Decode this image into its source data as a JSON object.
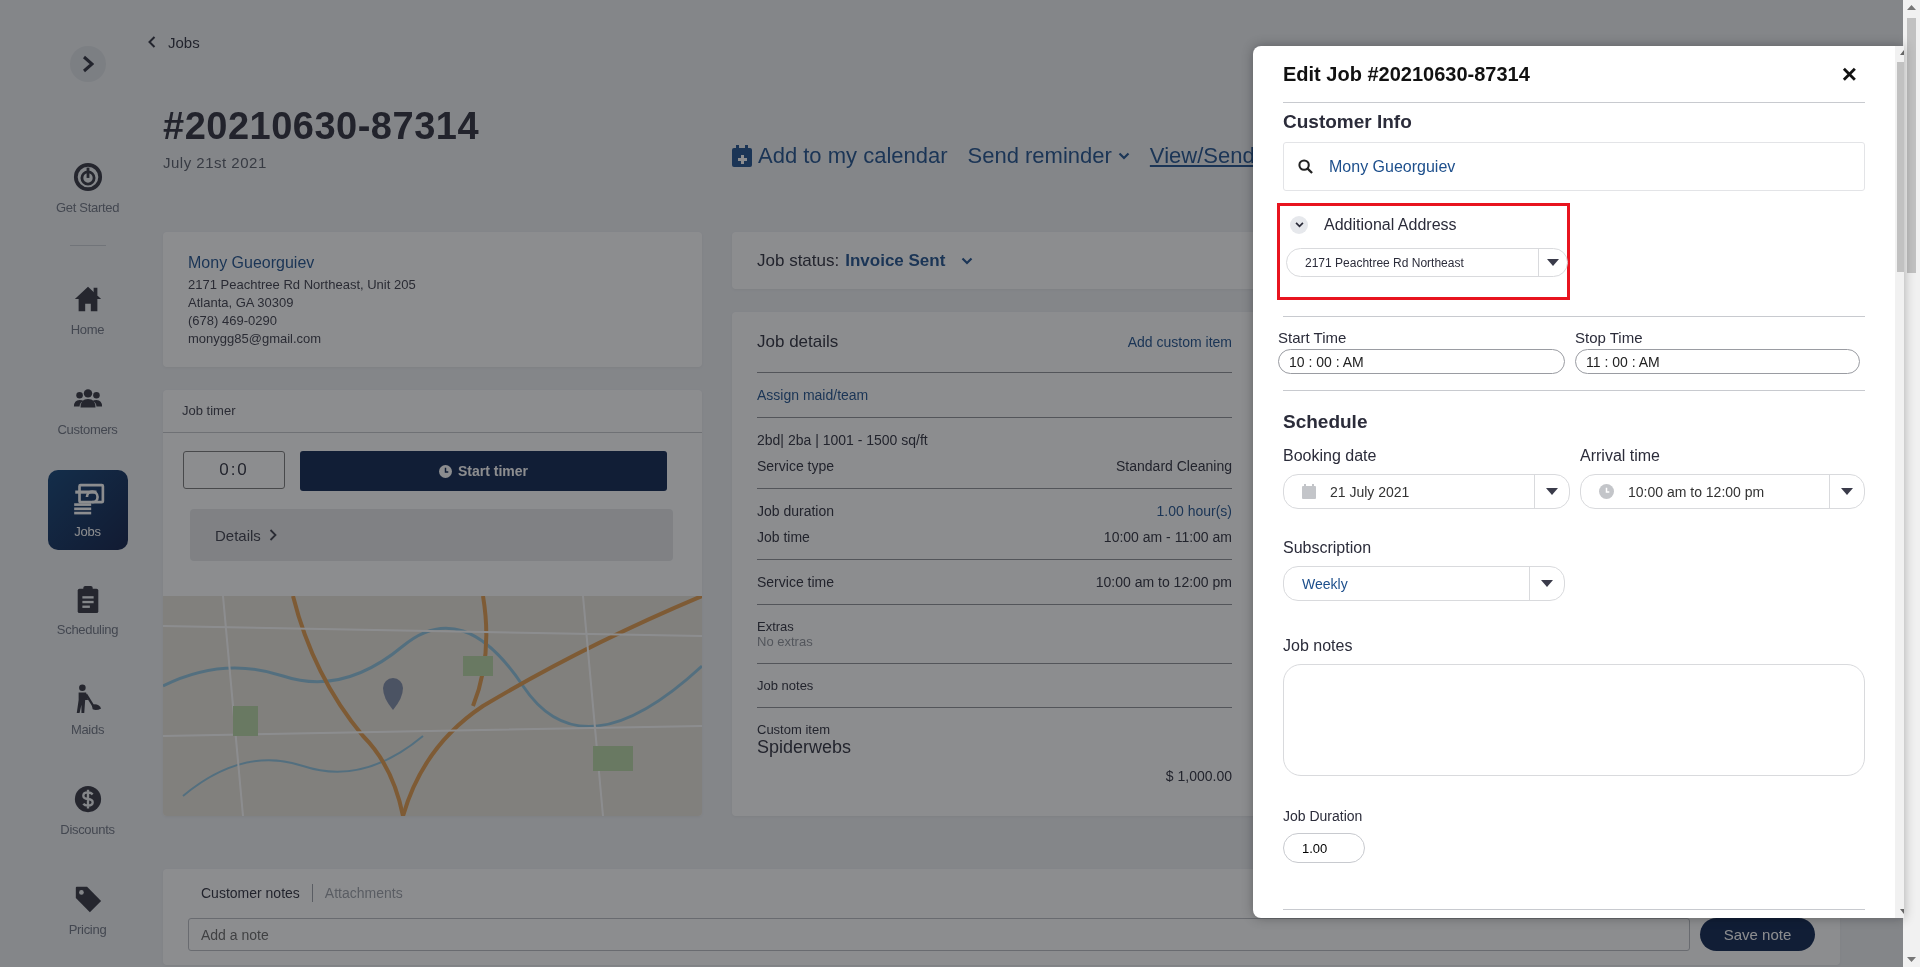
{
  "sidebar": {
    "items": [
      {
        "label": "Get Started",
        "selected": false
      },
      {
        "label": "Home",
        "selected": false
      },
      {
        "label": "Customers",
        "selected": false
      },
      {
        "label": "Jobs",
        "selected": true
      },
      {
        "label": "Scheduling",
        "selected": false
      },
      {
        "label": "Maids",
        "selected": false
      },
      {
        "label": "Discounts",
        "selected": false
      },
      {
        "label": "Pricing",
        "selected": false
      }
    ]
  },
  "breadcrumb": {
    "label": "Jobs"
  },
  "job": {
    "title": "#20210630-87314",
    "date": "July 21st 2021"
  },
  "actions": [
    {
      "kind": "calendar",
      "label": "Add to my calendar"
    },
    {
      "kind": "dropdown",
      "label": "Send reminder"
    },
    {
      "kind": "link",
      "label": "View/Send"
    }
  ],
  "customer_card": {
    "name": "Mony Gueorguiev",
    "lines": [
      "2171 Peachtree Rd Northeast, Unit 205",
      "Atlanta, GA 30309",
      "(678) 469-0290",
      "monygg85@gmail.com"
    ]
  },
  "job_timer": {
    "title": "Job timer",
    "display": "0:0",
    "button": "Start timer",
    "details": "Details"
  },
  "job_status": {
    "label": "Job status:",
    "value": "Invoice Sent"
  },
  "job_details": {
    "title": "Job details",
    "action": "Add custom item",
    "sections": [
      {
        "rows": [
          {
            "kind": "link",
            "label": "Assign maid/team"
          }
        ]
      },
      {
        "rows": [
          {
            "kind": "text",
            "label": "2bd| 2ba | 1001 - 1500 sq/ft"
          },
          {
            "kind": "pair",
            "label": "Service type",
            "value": "Standard Cleaning"
          }
        ]
      },
      {
        "rows": [
          {
            "kind": "pair_link",
            "label": "Job duration",
            "value": "1.00 hour(s)"
          },
          {
            "kind": "pair",
            "label": "Job time",
            "value": "10:00 am - 11:00 am"
          }
        ]
      },
      {
        "rows": [
          {
            "kind": "pair",
            "label": "Service time",
            "value": "10:00 am to 12:00 pm"
          }
        ]
      },
      {
        "rows": [
          {
            "kind": "stack_muted",
            "label": "Extras",
            "value": "No extras"
          }
        ]
      },
      {
        "rows": [
          {
            "kind": "text_small",
            "label": "Job notes"
          }
        ]
      },
      {
        "rows": [
          {
            "kind": "stack_large",
            "label": "Custom item",
            "value": "Spiderwebs"
          },
          {
            "kind": "price",
            "label": "$ 1,000.00"
          }
        ]
      }
    ]
  },
  "notes": {
    "tabs": [
      {
        "label": "Customer notes",
        "selected": true
      },
      {
        "label": "Attachments",
        "selected": false
      }
    ],
    "placeholder": "Add a note",
    "button": "Save note"
  },
  "modal": {
    "title": "Edit Job #20210630-87314",
    "close": "×",
    "customer_info": {
      "heading": "Customer Info",
      "value": "Mony Gueorguiev"
    },
    "additional_address": {
      "label": "Additional Address",
      "expanded": true,
      "highlighted": true,
      "value": "2171 Peachtree Rd Northeast"
    },
    "start_time": {
      "label": "Start Time",
      "value": "10 : 00 : AM"
    },
    "stop_time": {
      "label": "Stop Time",
      "value": "11 : 00 : AM"
    },
    "schedule": {
      "heading": "Schedule",
      "booking_date": {
        "label": "Booking date",
        "value": "21 July 2021"
      },
      "arrival_time": {
        "label": "Arrival time",
        "value": "10:00 am to 12:00 pm"
      }
    },
    "subscription": {
      "label": "Subscription",
      "value": "Weekly"
    },
    "job_notes": {
      "label": "Job notes"
    },
    "job_duration": {
      "label": "Job Duration",
      "value": "1.00"
    }
  }
}
